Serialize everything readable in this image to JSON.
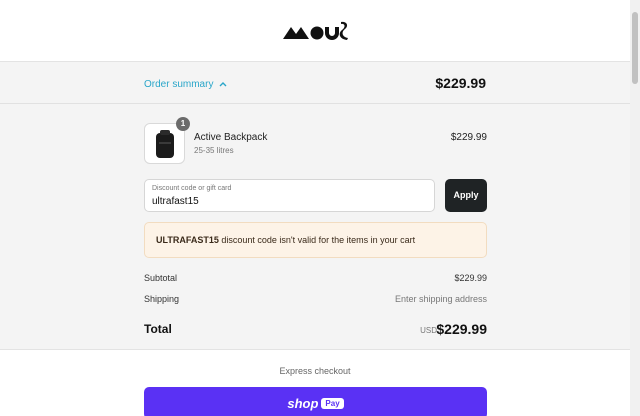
{
  "brand": {
    "logo_text": "mous",
    "logo_icon": "mous-logo-icon"
  },
  "summary": {
    "toggle_label": "Order summary",
    "toggle_icon": "chevron-up-icon",
    "total": "$229.99",
    "accent_color": "#2aa6c9"
  },
  "cart": {
    "items": [
      {
        "quantity": "1",
        "name": "Active Backpack",
        "variant": "25-35 litres",
        "price": "$229.99",
        "image_icon": "backpack-icon"
      }
    ]
  },
  "discount": {
    "label": "Discount code or gift card",
    "value": "ultrafast15",
    "apply_label": "Apply"
  },
  "error": {
    "code": "ULTRAFAST15",
    "message": " discount code isn't valid for the items in your cart"
  },
  "totals": {
    "subtotal_label": "Subtotal",
    "subtotal_value": "$229.99",
    "shipping_label": "Shipping",
    "shipping_value": "Enter shipping address",
    "total_label": "Total",
    "currency": "USD",
    "total_value": "$229.99"
  },
  "express": {
    "label": "Express checkout",
    "shop_word": "shop",
    "pay_word": "Pay",
    "button_color": "#5a31f4"
  }
}
